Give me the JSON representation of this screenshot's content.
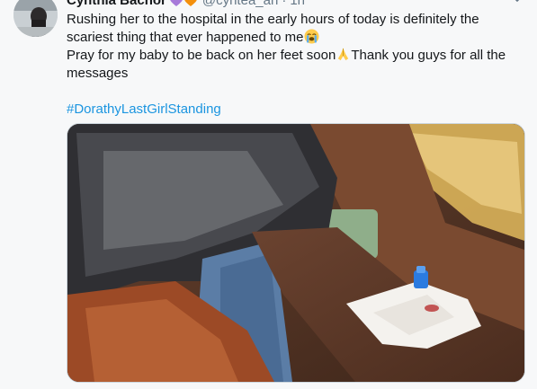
{
  "tweet": {
    "author_name": "Cynthia Bachor",
    "author_handle": "@cyntea_an",
    "separator": "·",
    "time": "1h",
    "line1": "Rushing her to the hospital in the early hours of today is definitely the scariest thing that ever happened to me",
    "line2a": "Pray for my baby to be back on her feet soon",
    "line2b": "Thank you guys for all the messages",
    "hashtag": "#DorathyLastGirlStanding",
    "icons": {
      "heart_purple": "purple-heart-icon",
      "heart_orange": "orange-heart-icon",
      "crying": "loudly-crying-face-icon",
      "pray": "folded-hands-icon",
      "caret": "chevron-down-icon"
    },
    "colors": {
      "link": "#1b95e0",
      "secondary": "#657786",
      "purple_heart": "#a77ad9",
      "orange_heart": "#f4900c"
    }
  }
}
